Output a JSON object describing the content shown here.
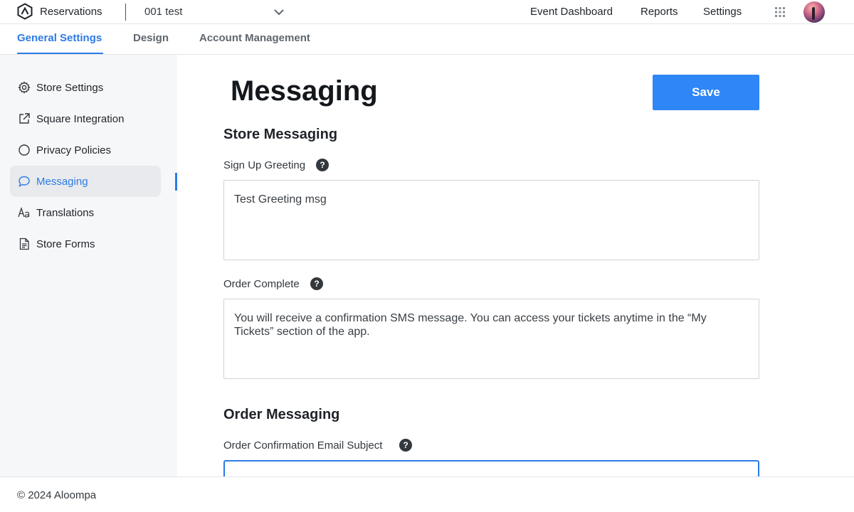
{
  "app": {
    "name": "Reservations",
    "store_selector": "001 test"
  },
  "top_nav": {
    "event_dashboard": "Event Dashboard",
    "reports": "Reports",
    "settings": "Settings"
  },
  "tabs": [
    {
      "label": "General Settings",
      "active": true
    },
    {
      "label": "Design",
      "active": false
    },
    {
      "label": "Account Management",
      "active": false
    }
  ],
  "sidebar": {
    "items": [
      {
        "label": "Store Settings",
        "icon": "gear-icon"
      },
      {
        "label": "Square Integration",
        "icon": "external-link-icon"
      },
      {
        "label": "Privacy Policies",
        "icon": "circle-icon"
      },
      {
        "label": "Messaging",
        "icon": "chat-bubble-icon",
        "active": true
      },
      {
        "label": "Translations",
        "icon": "text-aa-icon"
      },
      {
        "label": "Store Forms",
        "icon": "document-icon"
      }
    ]
  },
  "main": {
    "title": "Messaging",
    "save_label": "Save",
    "store_messaging": {
      "heading": "Store Messaging",
      "sign_up_greeting": {
        "label": "Sign Up Greeting",
        "value": "Test Greeting msg"
      },
      "order_complete": {
        "label": "Order Complete",
        "value": "You will receive a confirmation SMS message. You can access your tickets anytime in the “My Tickets” section of the app."
      }
    },
    "order_messaging": {
      "heading": "Order Messaging",
      "confirmation_subject": {
        "label": "Order Confirmation Email Subject",
        "value": ""
      }
    }
  },
  "help_glyph": "?",
  "footer": {
    "text": "© 2024 Aloompa"
  },
  "colors": {
    "accent": "#2c7be5",
    "save_button": "#2f86f6",
    "sidebar_bg": "#f6f7f9"
  }
}
